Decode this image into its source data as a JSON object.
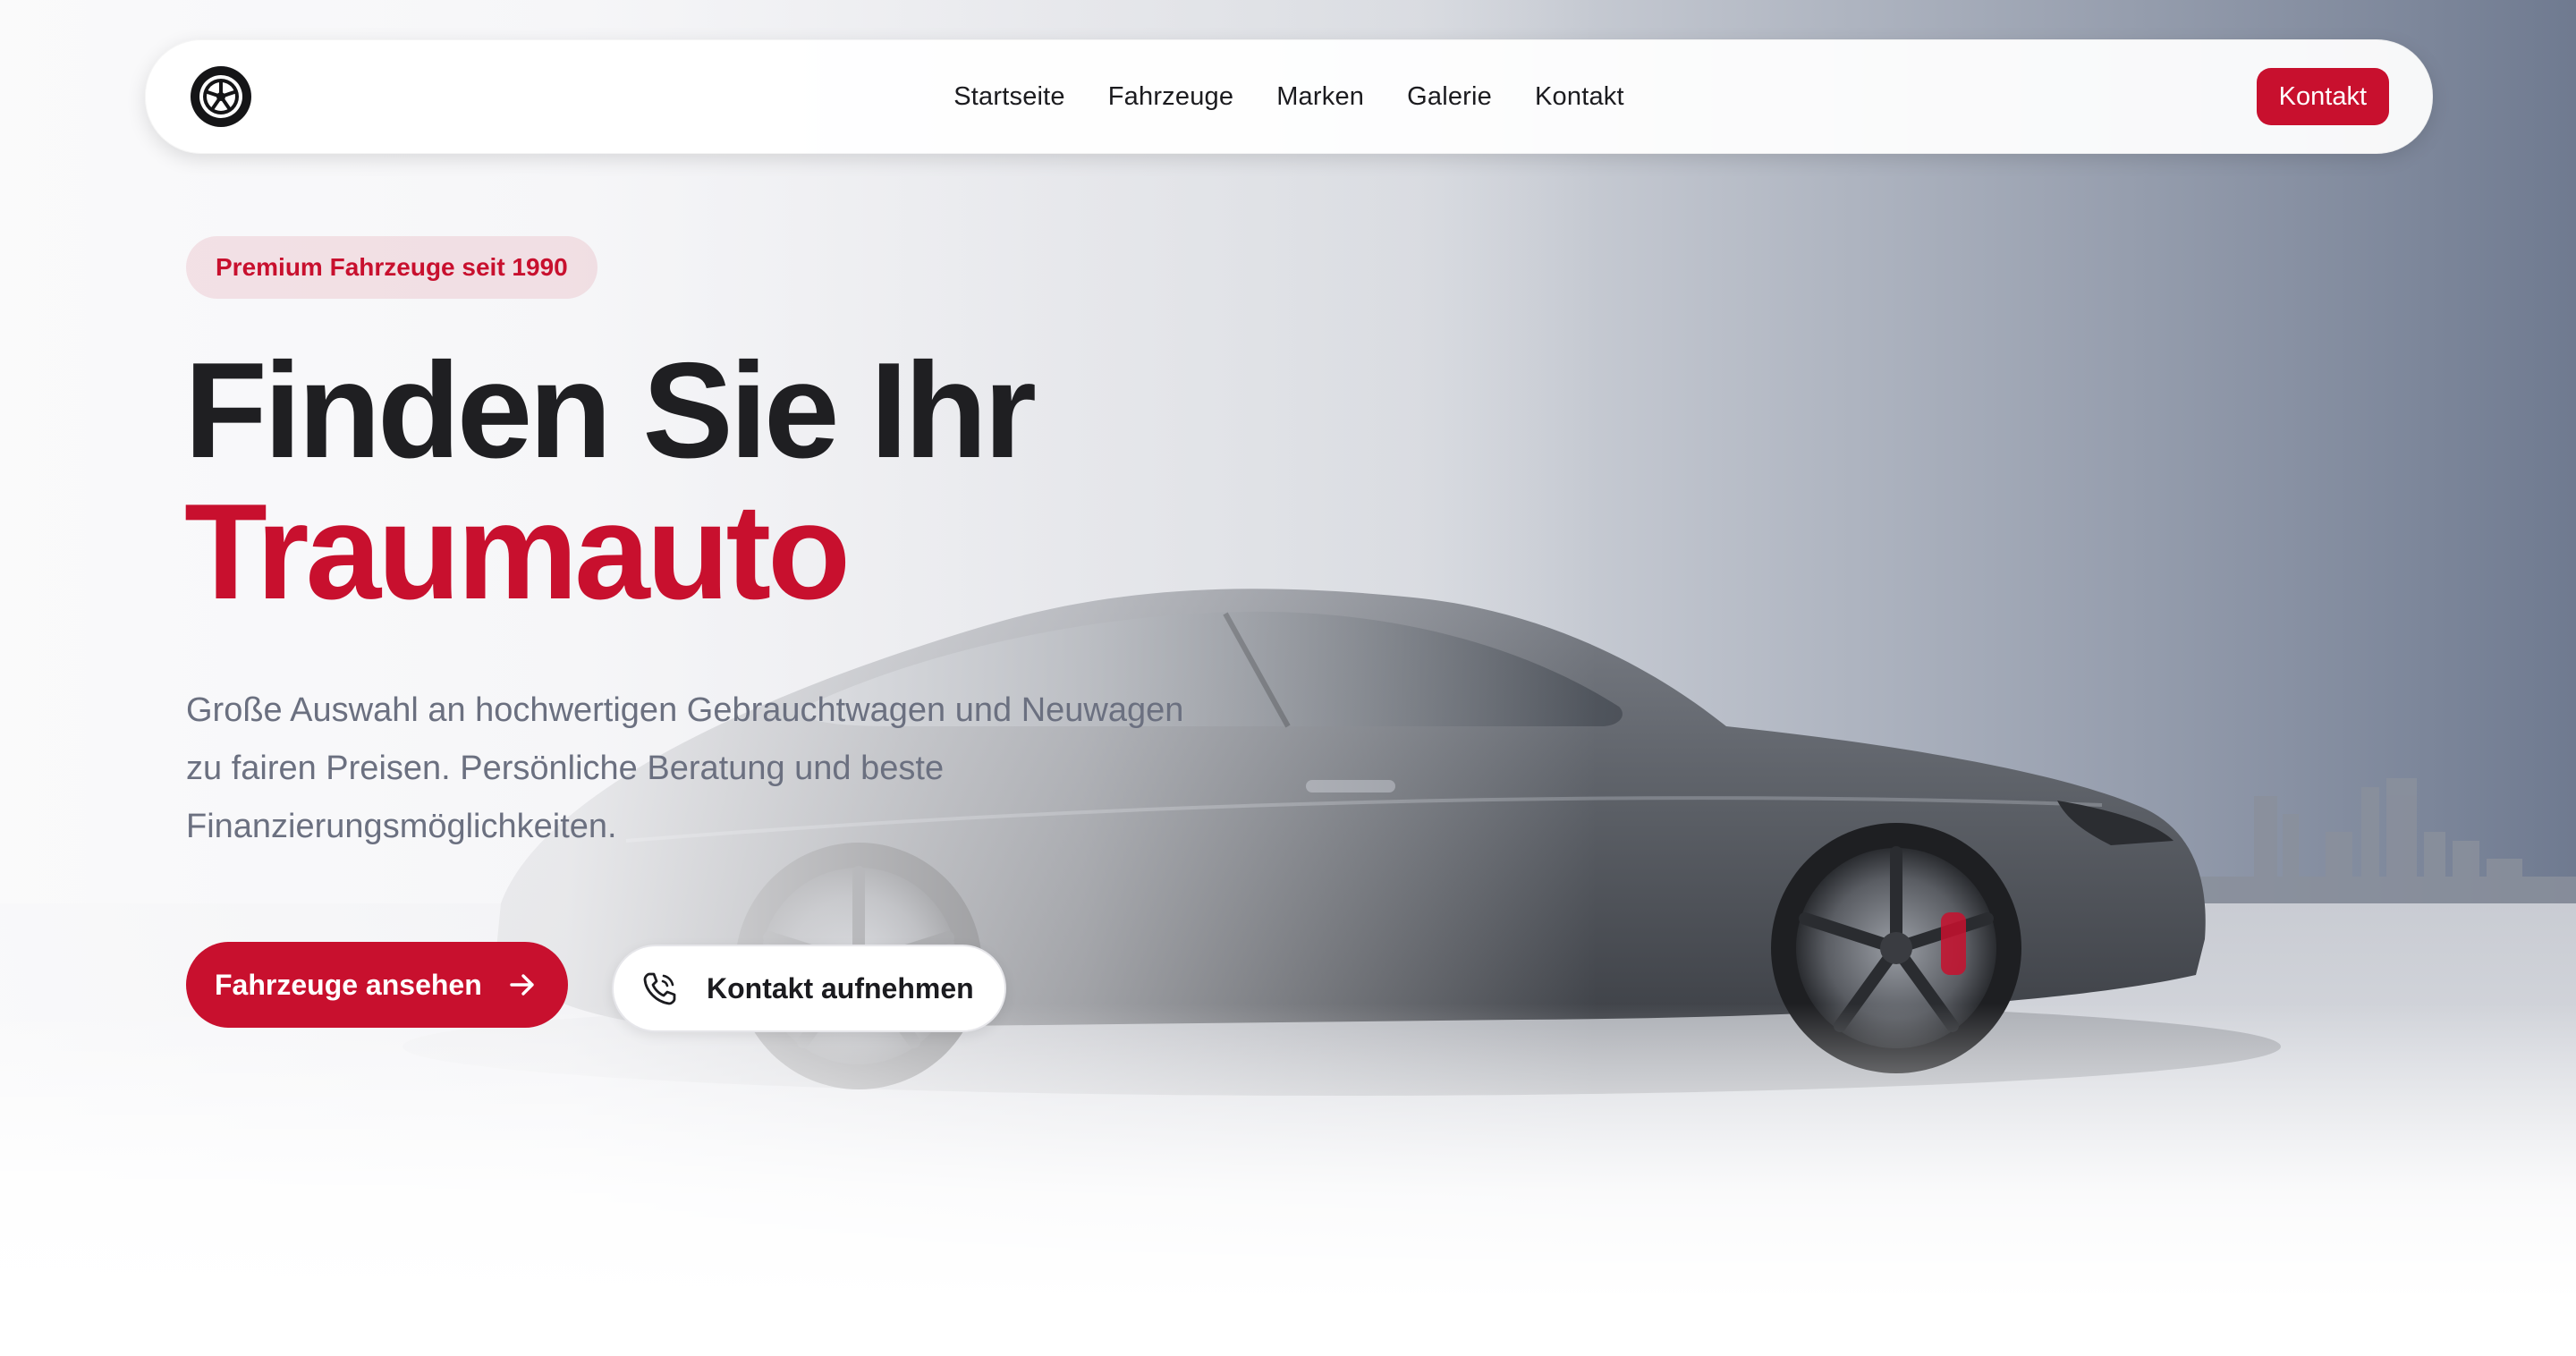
{
  "nav": {
    "links": [
      {
        "label": "Startseite"
      },
      {
        "label": "Fahrzeuge"
      },
      {
        "label": "Marken"
      },
      {
        "label": "Galerie"
      },
      {
        "label": "Kontakt"
      }
    ],
    "cta_label": "Kontakt",
    "logo_icon": "wheel-icon"
  },
  "hero": {
    "badge": "Premium Fahrzeuge seit 1990",
    "title_line1": "Finden Sie Ihr",
    "title_line2": "Traumauto",
    "description": "Große Auswahl an hochwertigen Gebrauchtwagen und Neuwagen zu fairen Preisen. Persönliche Beratung und beste Finanzierungsmöglichkeiten.",
    "primary_button": {
      "label": "Fahrzeuge ansehen",
      "icon": "arrow-right-icon"
    },
    "secondary_button": {
      "label": "Kontakt aufnehmen",
      "icon": "phone-icon"
    }
  },
  "colors": {
    "accent": "#c8102e",
    "text_dark": "#1f1f22",
    "text_muted": "#6b7080"
  }
}
